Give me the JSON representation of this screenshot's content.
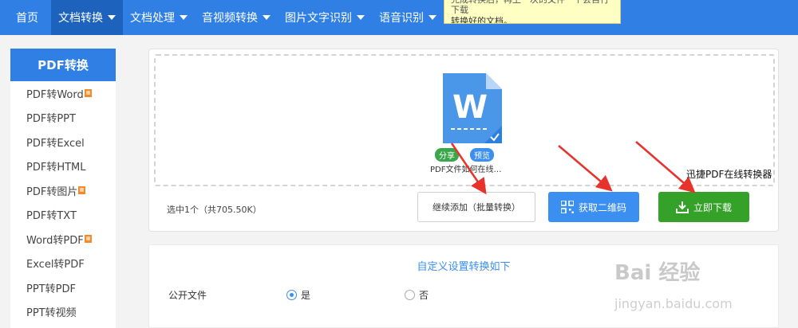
{
  "nav": {
    "items": [
      {
        "label": "首页",
        "dropdown": false
      },
      {
        "label": "文档转换",
        "dropdown": true,
        "active": true
      },
      {
        "label": "文档处理",
        "dropdown": true
      },
      {
        "label": "音视频转换",
        "dropdown": true
      },
      {
        "label": "图片文字识别",
        "dropdown": true
      },
      {
        "label": "语音识别",
        "dropdown": true
      }
    ]
  },
  "tooltip": {
    "line1": "完成转换后，再上一次的文件一个会自行下载",
    "line2": "转换好的文档。"
  },
  "sidebar": {
    "title": "PDF转换",
    "items": [
      {
        "label": "PDF转Word",
        "hot": true
      },
      {
        "label": "PDF转PPT",
        "hot": false
      },
      {
        "label": "PDF转Excel",
        "hot": false
      },
      {
        "label": "PDF转HTML",
        "hot": false
      },
      {
        "label": "PDF转图片",
        "hot": true
      },
      {
        "label": "PDF转TXT",
        "hot": false
      },
      {
        "label": "Word转PDF",
        "hot": true
      },
      {
        "label": "Excel转PDF",
        "hot": false
      },
      {
        "label": "PPT转PDF",
        "hot": false
      },
      {
        "label": "PPT转视频",
        "hot": false
      }
    ]
  },
  "upload": {
    "file_name": "PDF文件如何在线…",
    "share_label": "分享",
    "preview_label": "预览",
    "doc_letter": "W",
    "selected_info": "选中1个（共705.50K）",
    "add_button": "继续添加（批量转换）",
    "qr_button": "获取二维码",
    "download_button": "立即下载",
    "overlay_caption": "迅捷PDF在线转换器"
  },
  "settings": {
    "title": "自定义设置转换如下",
    "public_label": "公开文件",
    "option_yes": "是",
    "option_no": "否",
    "selected": "是"
  },
  "watermark": {
    "brand": "Bai 经验",
    "url": "jingyan.baidu.com"
  },
  "colors": {
    "nav": "#2f7fe5",
    "nav_active": "#1d63bd",
    "qr_button": "#3b8ff0",
    "download_button": "#34a229",
    "arrow": "#e8322c",
    "doc_blue": "#4a97ea"
  }
}
